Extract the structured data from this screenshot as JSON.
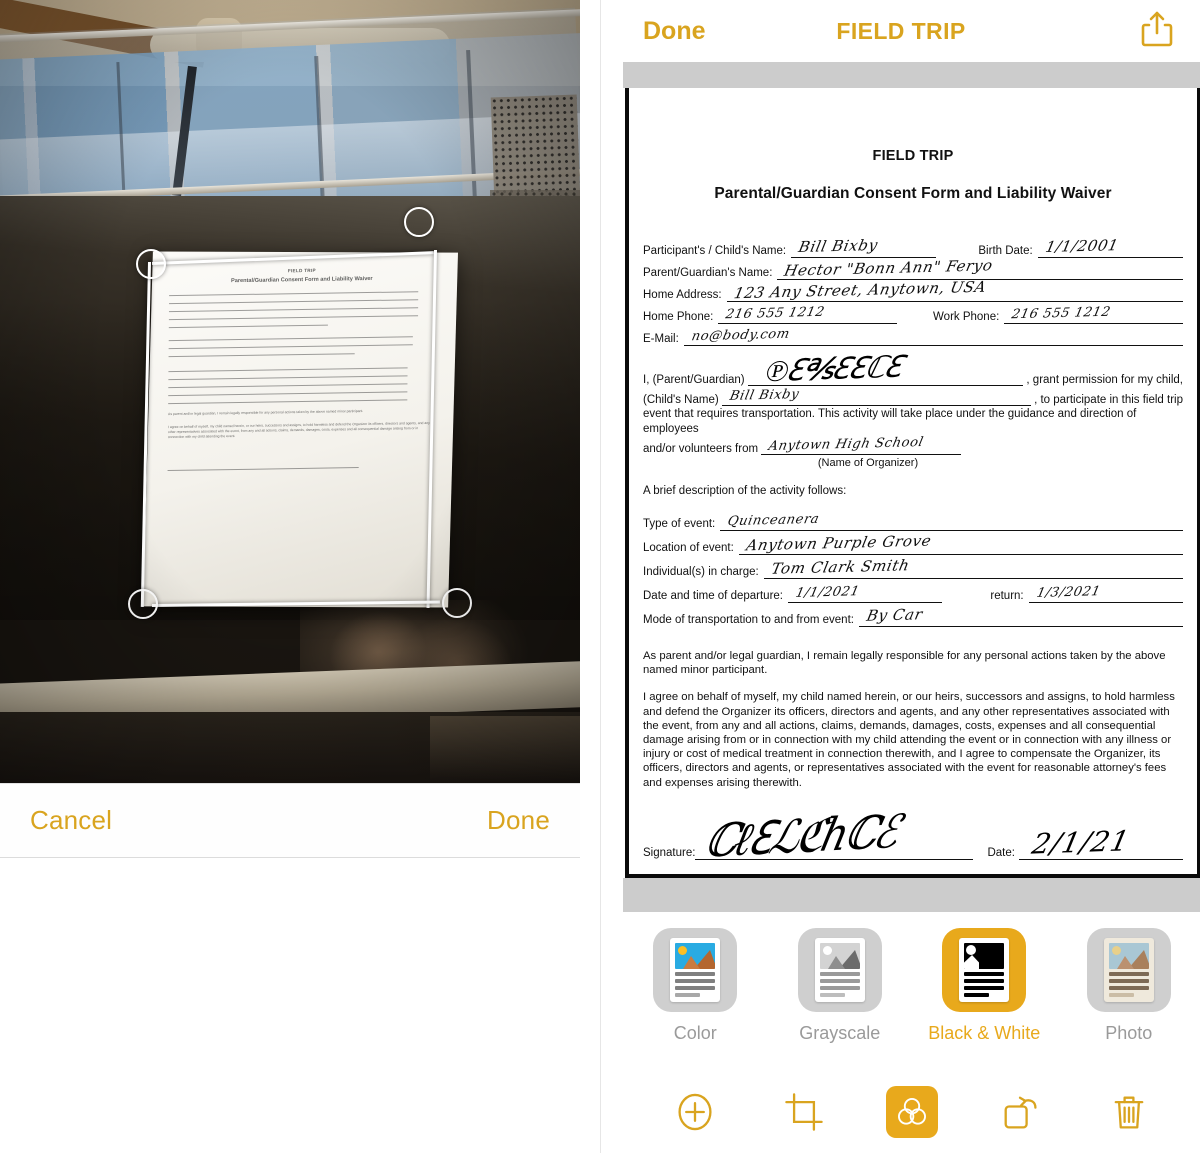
{
  "app": {
    "accent_color": "#d9a41f",
    "accent_tile_color": "#e8a91c",
    "gray_band_color": "#cccccc"
  },
  "scan_panel": {
    "cancel_label": "Cancel",
    "done_label": "Done",
    "crop_handles": 4,
    "scan_doc": {
      "title": "FIELD TRIP",
      "subtitle": "Parental/Guardian Consent Form and Liability Waiver"
    }
  },
  "nav": {
    "done_label": "Done",
    "title": "FIELD TRIP",
    "share_icon": "share-icon"
  },
  "document": {
    "title": "FIELD TRIP",
    "subtitle": "Parental/Guardian Consent Form and Liability Waiver",
    "fields": [
      {
        "label": "Participant's / Child's Name:",
        "value": "Bill Bixby"
      },
      {
        "label": "Birth Date:",
        "value": "1/1/2001"
      },
      {
        "label": "Parent/Guardian's Name:",
        "value": "Hector \"Bonn Ann\" Feryo"
      },
      {
        "label": "Home Address:",
        "value": "123 Any Street, Anytown, USA"
      },
      {
        "label": "Home Phone:",
        "value": "216 555 1212"
      },
      {
        "label": "Work Phone:",
        "value": "216 555 1212"
      },
      {
        "label": "E-Mail:",
        "value": "no@body.com"
      }
    ],
    "consent": {
      "line1_label": "I, (Parent/Guardian)",
      "line1_value": "signature-scrawl",
      "line1_tail": ", grant permission for my child,",
      "line2_label": "(Child's Name)",
      "line2_value": "Bill Bixby",
      "line2_tail": ", to participate in this field trip",
      "flow_text": "event that requires transportation. This activity will take place under the guidance and direction of employees",
      "line3_label": "and/or volunteers from",
      "line3_value": "Anytown High School",
      "organizer_caption": "(Name of Organizer)"
    },
    "activity_heading": "A brief description of the activity follows:",
    "activity_fields": [
      {
        "label": "Type of event:",
        "value": "Quinceanera"
      },
      {
        "label": "Location of event:",
        "value": "Anytown Purple Grove"
      },
      {
        "label": "Individual(s) in charge:",
        "value": "Tom Clark Smith"
      },
      {
        "label": "Date and time of departure:",
        "value": "1/1/2021"
      },
      {
        "label": "return:",
        "value": "1/3/2021"
      },
      {
        "label": "Mode of transportation to and from event:",
        "value": "By Car"
      }
    ],
    "legal_paragraphs": [
      "As parent and/or legal guardian, I remain legally responsible for any personal actions taken by the above named minor participant.",
      "I agree on behalf of myself, my child named herein, or our heirs, successors and assigns, to hold harmless and defend the Organizer its officers, directors and agents, and any other representatives associated with the event, from any and all actions, claims, demands, damages, costs, expenses and all consequential damage arising from or in connection with my child attending the event or in connection with any illness or injury or cost of medical treatment in connection therewith, and I agree to compensate the Organizer, its officers, directors and agents, or representatives associated with the event for reasonable attorney's fees and expenses arising therewith."
    ],
    "signature_label": "Signature:",
    "signature_value": "handwritten-signature",
    "date_label": "Date:",
    "date_value": "2/1/21"
  },
  "filters": {
    "items": [
      {
        "label": "Color",
        "icon": "color-filter-icon",
        "selected": false
      },
      {
        "label": "Grayscale",
        "icon": "grayscale-filter-icon",
        "selected": false
      },
      {
        "label": "Black & White",
        "icon": "black-white-filter-icon",
        "selected": true
      },
      {
        "label": "Photo",
        "icon": "photo-filter-icon",
        "selected": false
      }
    ]
  },
  "toolbar": {
    "items": [
      {
        "name": "add-page-button",
        "icon": "plus-circle-icon",
        "active": false
      },
      {
        "name": "crop-button",
        "icon": "crop-icon",
        "active": false
      },
      {
        "name": "filters-button",
        "icon": "color-filters-icon",
        "active": true
      },
      {
        "name": "rotate-button",
        "icon": "rotate-icon",
        "active": false
      },
      {
        "name": "delete-button",
        "icon": "trash-icon",
        "active": false
      }
    ]
  }
}
